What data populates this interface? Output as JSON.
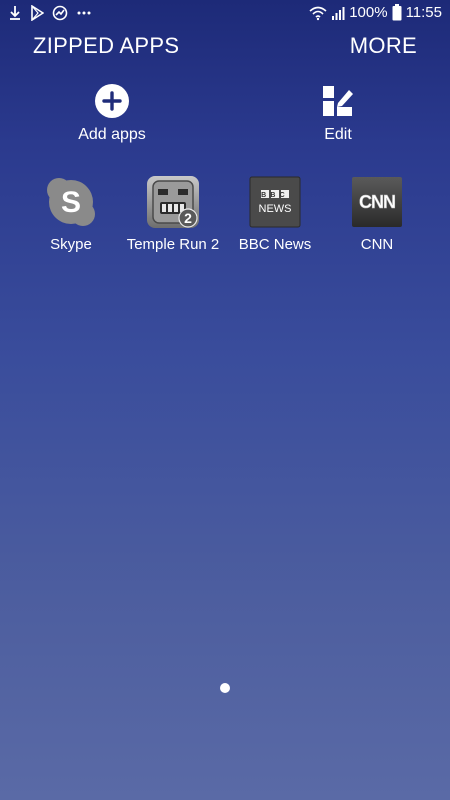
{
  "status_bar": {
    "battery": "100%",
    "time": "11:55",
    "left_icons": [
      "download-icon",
      "play-store-icon",
      "trend-icon",
      "more-dots-icon"
    ],
    "right_icons": [
      "wifi-icon",
      "signal-icon",
      "battery-icon"
    ]
  },
  "header": {
    "title": "ZIPPED APPS",
    "more_label": "MORE"
  },
  "actions": {
    "add_label": "Add apps",
    "edit_label": "Edit"
  },
  "apps": [
    {
      "label": "Skype",
      "icon": "skype-icon"
    },
    {
      "label": "Temple Run 2",
      "icon": "temple-run-icon",
      "badge": "2"
    },
    {
      "label": "BBC News",
      "icon": "bbc-news-icon",
      "line1": "BBC",
      "line2": "NEWS"
    },
    {
      "label": "CNN",
      "icon": "cnn-icon",
      "logo_text": "CNN"
    }
  ],
  "colors": {
    "background_top": "#1d2a78",
    "background_bottom": "#5a6aa6",
    "text": "#ffffff"
  }
}
